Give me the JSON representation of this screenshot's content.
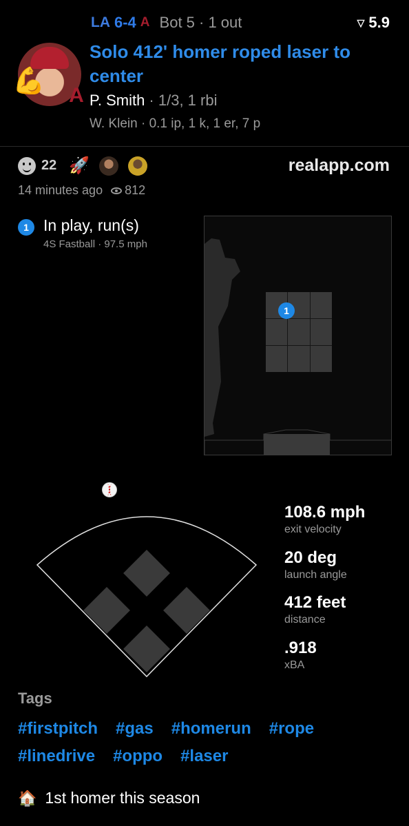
{
  "game": {
    "away_team": "LA",
    "score": "6-4",
    "home_team": "A",
    "inning_state": "Bot 5 · 1 out",
    "rating": "5.9"
  },
  "play": {
    "headline": "Solo 412' homer roped laser to center",
    "batter_name": "P. Smith",
    "batter_line": " · 1/3, 1 rbi",
    "pitcher_line": "W. Klein · 0.1 ip, 1 k, 1 er, 7 p"
  },
  "social": {
    "reaction_count": "22",
    "rocket": "🚀",
    "brand": "realapp.com",
    "time_ago": "14 minutes ago",
    "views": "812"
  },
  "pitch": {
    "number": "1",
    "result": "In play, run(s)",
    "type": "4S Fastball ·  97.5 mph",
    "zone_marker": "1"
  },
  "stats": [
    {
      "value": "108.6 mph",
      "label": "exit velocity"
    },
    {
      "value": "20 deg",
      "label": "launch angle"
    },
    {
      "value": "412 feet",
      "label": "distance"
    },
    {
      "value": ".918",
      "label": "xBA"
    }
  ],
  "tags": {
    "title": "Tags",
    "items": [
      "#firstpitch",
      "#gas",
      "#homerun",
      "#rope",
      "#linedrive",
      "#oppo",
      "#laser"
    ]
  },
  "note": {
    "icon": "🏠",
    "text": "1st homer this season"
  },
  "colors": {
    "accent": "#1e88e5",
    "headline": "#2f8be8",
    "muted": "#9a9a9a",
    "background": "#000000",
    "diamond": "#3a3a3a"
  }
}
